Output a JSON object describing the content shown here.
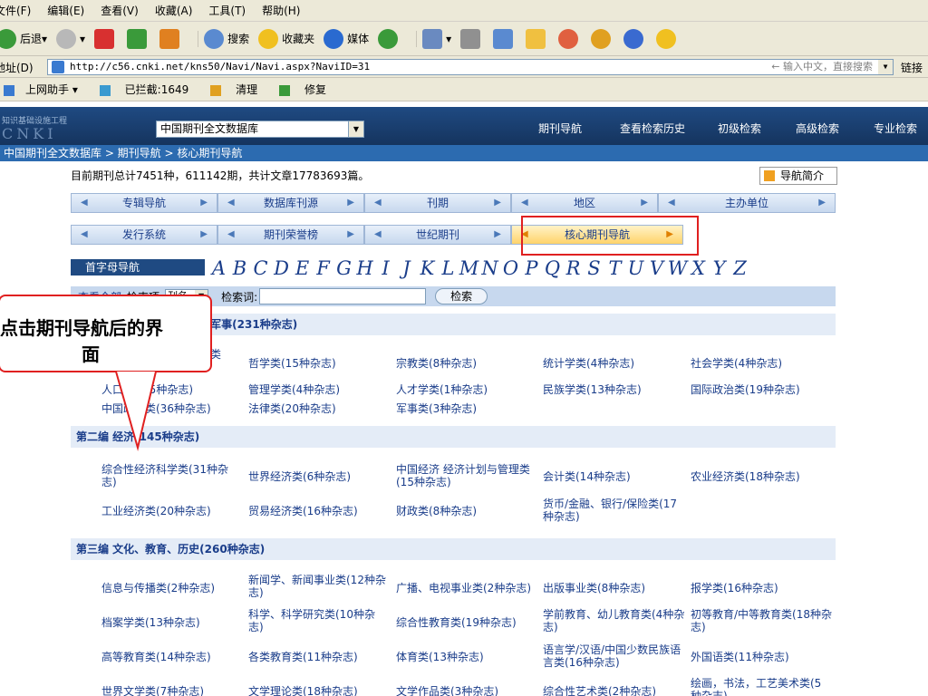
{
  "browser": {
    "menu": [
      "文件(F)",
      "编辑(E)",
      "查看(V)",
      "收藏(A)",
      "工具(T)",
      "帮助(H)"
    ],
    "toolbar": {
      "back": "后退",
      "search": "搜索",
      "favorites": "收藏夹",
      "media": "媒体"
    },
    "address_label": "地址(D)",
    "address_url": "http://c56.cnki.net/kns50/Navi/Navi.aspx?NaviID=31",
    "address_hint": "← 输入中文，直接搜索",
    "links_label": "链接",
    "links": [
      "上网助手 ▾",
      "已拦截:1649",
      "清理",
      "修复"
    ]
  },
  "site": {
    "logo_text": "知识基础设施工程",
    "logo_big": "CNKI",
    "db_select": "中国期刊全文数据库",
    "nav": [
      "期刊导航",
      "查看检索历史",
      "初级检索",
      "高级检索",
      "专业检索"
    ],
    "breadcrumb": "中国期刊全文数据库 > 期刊导航 > 核心期刊导航",
    "summary": "目前期刊总计7451种，611142期，共计文章17783693篇。",
    "intro_button": "导航简介",
    "tabs_row1": [
      "专辑导航",
      "数据库刊源",
      "刊期",
      "地区",
      "主办单位"
    ],
    "tabs_row2": [
      "发行系统",
      "期刊荣誉榜",
      "世纪期刊",
      "核心期刊导航"
    ],
    "letter_label": "首字母导航",
    "letters": [
      "A",
      "B",
      "C",
      "D",
      "E",
      "F",
      "G",
      "H",
      "I",
      "J",
      "K",
      "L",
      "M",
      "N",
      "O",
      "P",
      "Q",
      "R",
      "S",
      "T",
      "U",
      "V",
      "W",
      "X",
      "Y",
      "Z"
    ],
    "search": {
      "show_all": "查看全部",
      "field_label": "检索项:",
      "field_value": "刊名",
      "term_label": "检索词:",
      "button": "检索"
    }
  },
  "sections": [
    {
      "title": "第一编 哲学、政治、法律、军事(231种杂志)",
      "items": [
        "综合性人文、社会科学类(59种杂志)",
        "哲学类(15种杂志)",
        "宗教类(8种杂志)",
        "统计学类(4种杂志)",
        "社会学类(4种杂志)",
        "人口学类(5种杂志)",
        "管理学类(4种杂志)",
        "人才学类(1种杂志)",
        "民族学类(13种杂志)",
        "国际政治类(19种杂志)",
        "中国政治类(36种杂志)",
        "法律类(20种杂志)",
        "军事类(3种杂志)"
      ]
    },
    {
      "title": "第二编 经济(145种杂志)",
      "items": [
        "综合性经济科学类(31种杂志)",
        "世界经济类(6种杂志)",
        "中国经济 经济计划与管理类(15种杂志)",
        "会计类(14种杂志)",
        "农业经济类(18种杂志)",
        "工业经济类(20种杂志)",
        "贸易经济类(16种杂志)",
        "财政类(8种杂志)",
        "货币/金融、银行/保险类(17种杂志)"
      ]
    },
    {
      "title": "第三编 文化、教育、历史(260种杂志)",
      "items": [
        "信息与传播类(2种杂志)",
        "新闻学、新闻事业类(12种杂志)",
        "广播、电视事业类(2种杂志)",
        "出版事业类(8种杂志)",
        "报学类(16种杂志)",
        "档案学类(13种杂志)",
        "科学、科学研究类(10种杂志)",
        "综合性教育类(19种杂志)",
        "学前教育、幼儿教育类(4种杂志)",
        "初等教育/中等教育类(18种杂志)",
        "高等教育类(14种杂志)",
        "各类教育类(11种杂志)",
        "体育类(13种杂志)",
        "语言学/汉语/中国少数民族语言类(16种杂志)",
        "外国语类(11种杂志)",
        "世界文学类(7种杂志)",
        "文学理论类(18种杂志)",
        "文学作品类(3种杂志)",
        "综合性艺术类(2种杂志)",
        "绘画，书法，工艺美术类(5种杂志)"
      ]
    }
  ],
  "annotation": {
    "line1": "点击期刊导航后的界",
    "line2": "面"
  }
}
